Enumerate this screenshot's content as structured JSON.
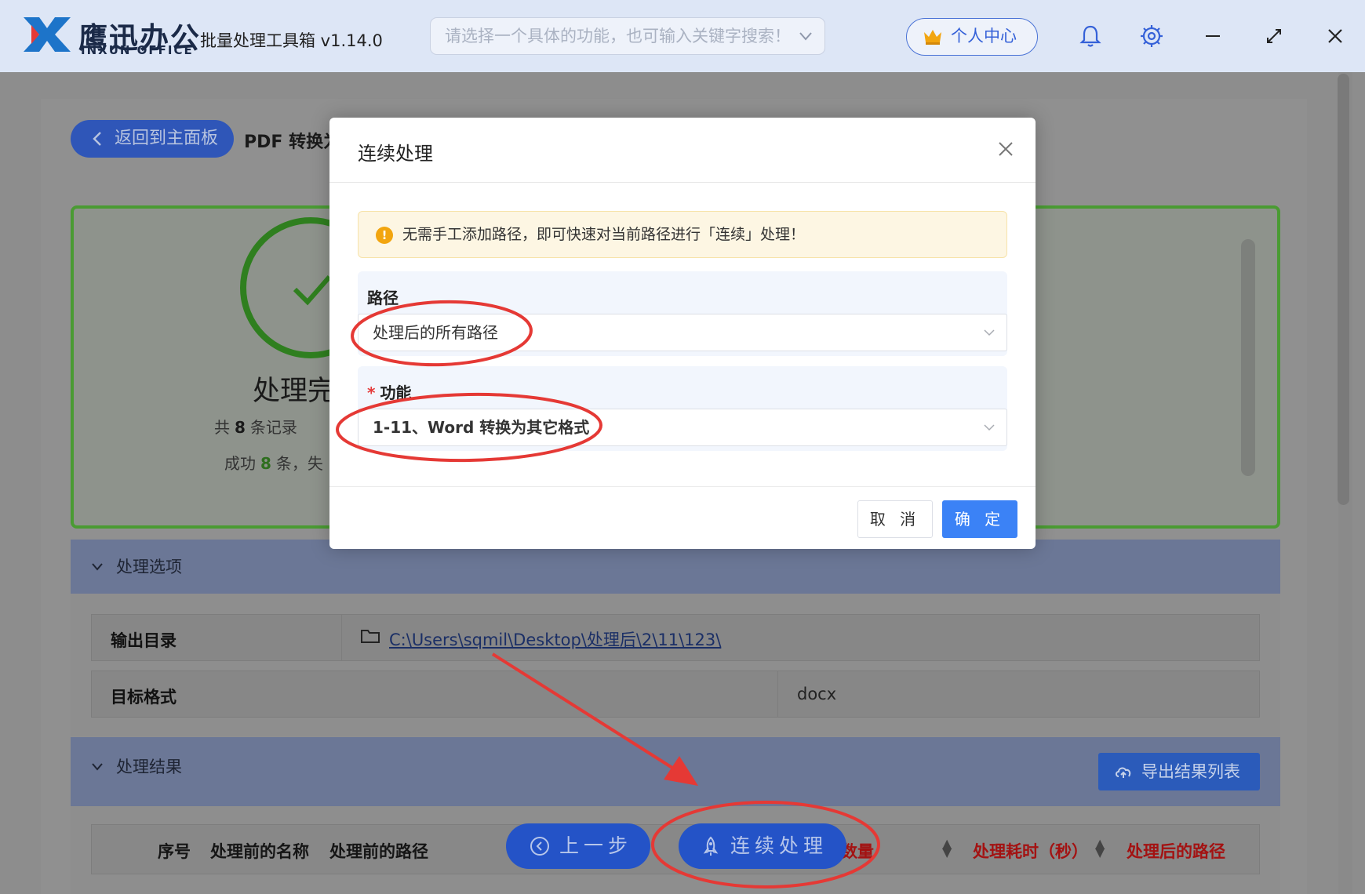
{
  "titlebar": {
    "brand_cn": "鹰迅办公",
    "brand_en": "INXUN OFFICE",
    "app_title": "批量处理工具箱 v1.14.0",
    "search_placeholder": "请选择一个具体的功能，也可输入关键字搜索！",
    "user_center": "个人中心"
  },
  "page": {
    "back_label": "返回到主面板",
    "title": "PDF 转换为"
  },
  "status": {
    "done_text": "处理完",
    "count_prefix": "共",
    "count_value": "8",
    "count_suffix": "条记录",
    "success_prefix": "成功",
    "success_value": "8",
    "success_suffix": "条，失"
  },
  "options": {
    "header": "处理选项",
    "output_dir_label": "输出目录",
    "output_dir_value": "C:\\Users\\sqmil\\Desktop\\处理后\\2\\11\\123\\",
    "target_format_label": "目标格式",
    "target_format_value": "docx"
  },
  "results": {
    "header": "处理结果",
    "export_label": "导出结果列表",
    "columns": [
      "序号",
      "处理前的名称",
      "处理前的路径",
      "处理数量",
      "处理耗时（秒）",
      "处理后的路径"
    ]
  },
  "bottom": {
    "prev_label": "上一步",
    "continue_label": "连续处理"
  },
  "modal": {
    "title": "连续处理",
    "alert": "无需手工添加路径，即可快速对当前路径进行「连续」处理！",
    "path_label": "路径",
    "path_value": "处理后的所有路径",
    "function_required": "*",
    "function_label": "功能",
    "function_value": "1-11、Word 转换为其它格式",
    "cancel_label": "取 消",
    "confirm_label": "确 定"
  },
  "colors": {
    "primary": "#3b82f6",
    "annotation": "#e53935",
    "success": "#4a9b33"
  }
}
